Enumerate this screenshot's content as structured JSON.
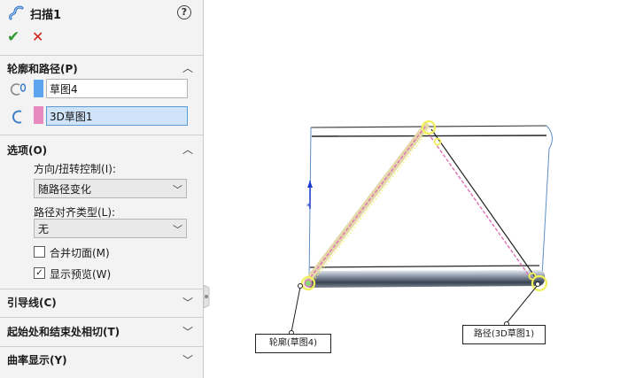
{
  "feature": {
    "title": "扫描1",
    "icon": "sweep-feature-icon",
    "help_glyph": "?"
  },
  "actions": {
    "ok_glyph": "✔",
    "cancel_glyph": "✕"
  },
  "sections": {
    "profile_path": {
      "label": "轮廓和路径(P)",
      "expanded": true,
      "profile_value": "草图4",
      "path_value": "3D草图1",
      "profile_color": "#5aa5ee",
      "path_color": "#e88ac0"
    },
    "options": {
      "label": "选项(O)",
      "expanded": true,
      "orientation_label": "方向/扭转控制(I):",
      "orientation_value": "随路径变化",
      "alignment_label": "路径对齐类型(L):",
      "alignment_value": "无",
      "merge_faces_label": "合并切面(M)",
      "merge_faces_checked": false,
      "show_preview_label": "显示预览(W)",
      "show_preview_checked": true,
      "check_glyph": "✓"
    },
    "guide_curves": {
      "label": "引导线(C)",
      "expanded": false
    },
    "tangency": {
      "label": "起始处和结束处相切(T)",
      "expanded": false
    },
    "curvature": {
      "label": "曲率显示(Y)",
      "expanded": false
    }
  },
  "viewport": {
    "profile_callout": "轮廓(草图4)",
    "path_callout": "路径(3D草图1)"
  },
  "colors": {
    "panel_bg": "#f3f3f3",
    "accent_blue": "#5a9bd8",
    "ok_green": "#2f9a31",
    "cancel_red": "#d0201b",
    "path_pink": "#e070b8",
    "highlight_yellow": "#f1f25a",
    "edge_blue": "#5c8fc4"
  }
}
